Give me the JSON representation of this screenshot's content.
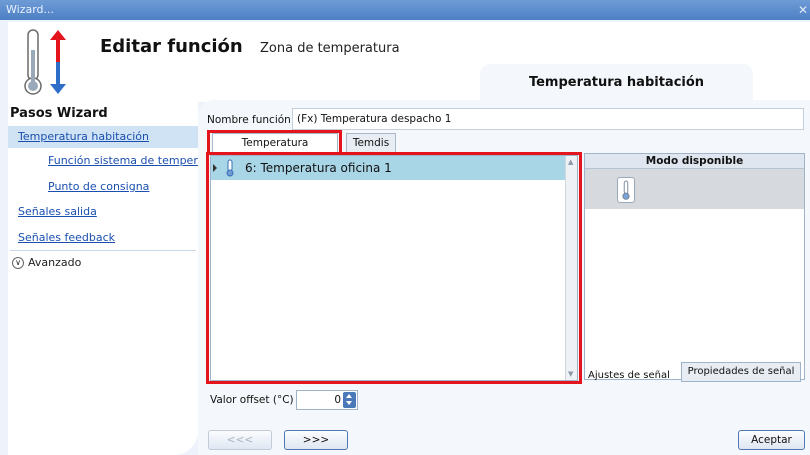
{
  "window": {
    "title": "Wizard..."
  },
  "header": {
    "title": "Editar función",
    "subtitle": "Zona de temperatura",
    "active_tab": "Temperatura habitación"
  },
  "sidebar": {
    "heading": "Pasos Wizard",
    "items": [
      {
        "label": "Temperatura habitación"
      },
      {
        "label": "Función sistema de temperatura"
      },
      {
        "label": "Punto de consigna"
      },
      {
        "label": "Señales salida"
      },
      {
        "label": "Señales feedback"
      }
    ],
    "advanced_label": "Avanzado"
  },
  "main": {
    "function_name_label": "Nombre función:",
    "function_name_value": "(Fx) Temperatura despacho 1",
    "tabs": [
      {
        "label": "Temperatura habitación"
      },
      {
        "label": "Temdis"
      }
    ],
    "list_rows": [
      {
        "label": "6: Temperatura oficina 1"
      }
    ],
    "mode_panel": {
      "header": "Modo disponible",
      "icon": "thermometer-icon"
    },
    "signal_settings_label": "Ajustes de señal",
    "signal_properties_label": "Propiedades de señal",
    "offset_label": "Valor offset (°C)",
    "offset_value": "0"
  },
  "buttons": {
    "prev": "<<<",
    "next": ">>>",
    "accept": "Aceptar"
  },
  "colors": {
    "titlebar": "#5b8bcb",
    "selection": "#a9d6e6",
    "highlight_border": "#e3141c",
    "link": "#1a4fb0"
  }
}
